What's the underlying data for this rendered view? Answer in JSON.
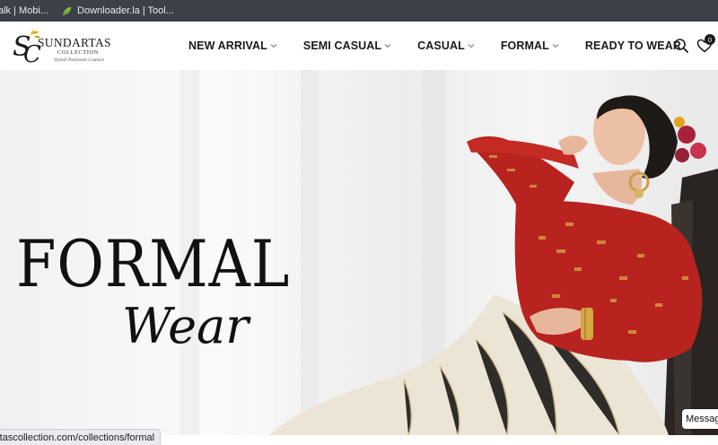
{
  "bookmarks": [
    {
      "label": "alk | Mobi...",
      "icon": "site-favicon"
    },
    {
      "label": "Downloader.la | Tool...",
      "icon": "leaf-favicon"
    }
  ],
  "brand": {
    "name": "SUNDARTAS",
    "subtitle": "COLLECTION",
    "tagline": "Stylish Pakistani Couture",
    "monogram": "SC"
  },
  "nav": {
    "items": [
      {
        "label": "NEW ARRIVAL",
        "has_dropdown": true
      },
      {
        "label": "SEMI CASUAL",
        "has_dropdown": true
      },
      {
        "label": "CASUAL",
        "has_dropdown": true
      },
      {
        "label": "FORMAL",
        "has_dropdown": true
      },
      {
        "label": "READY TO WEAR",
        "has_dropdown": false
      }
    ]
  },
  "header_icons": {
    "search": "search-icon",
    "wishlist": "heart-icon",
    "wishlist_count": "0"
  },
  "hero": {
    "headline": "FORMAL",
    "subline": "Wear"
  },
  "status_bar": {
    "url": "rtascollection.com/collections/formal"
  },
  "chat": {
    "label": "Message"
  },
  "colors": {
    "bookmarks_bar": "#3b4049",
    "dress_red": "#b8231f",
    "gold": "#d4a843",
    "text_dark": "#1a1a1a"
  }
}
